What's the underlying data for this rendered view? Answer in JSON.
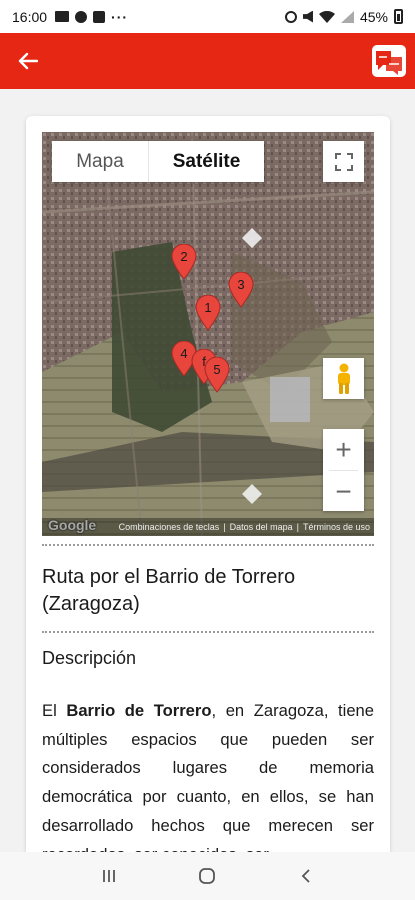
{
  "status_bar": {
    "time": "16:00",
    "battery": "45%",
    "notification_icons": [
      "image-icon",
      "chat-icon",
      "linkedin-icon",
      "more-dots-icon"
    ],
    "system_icons": [
      "alarm-icon",
      "mute-icon",
      "wifi-icon",
      "signal-icon",
      "battery-icon"
    ]
  },
  "app_bar": {
    "color": "#e52713",
    "back_icon": "arrow-left-icon",
    "logo_icon": "app-logo-icon"
  },
  "map": {
    "type_control": {
      "map_label": "Mapa",
      "satellite_label": "Satélite",
      "selected": "Satélite"
    },
    "markers": [
      "1",
      "2",
      "3",
      "4",
      "f",
      "5"
    ],
    "google_label": "Google",
    "footer": {
      "shortcuts": "Combinaciones de teclas",
      "map_data": "Datos del mapa",
      "terms": "Términos de uso"
    },
    "zoom_in": "+",
    "zoom_out": "−"
  },
  "route": {
    "title": "Ruta por el Barrio de Torrero (Zaragoza)",
    "description_heading": "Descripción",
    "description": {
      "prefix": "El ",
      "bold": "Barrio de Torrero",
      "rest": ", en Zaragoza, tiene múltiples espacios que pueden ser considerados lugares de memoria democrática por cuanto, en ellos, se han desarrollado hechos que merecen ser recordados, ser conocidos, ser"
    }
  },
  "nav_bar": {
    "items": [
      "recent-apps-icon",
      "home-icon",
      "back-icon"
    ]
  }
}
